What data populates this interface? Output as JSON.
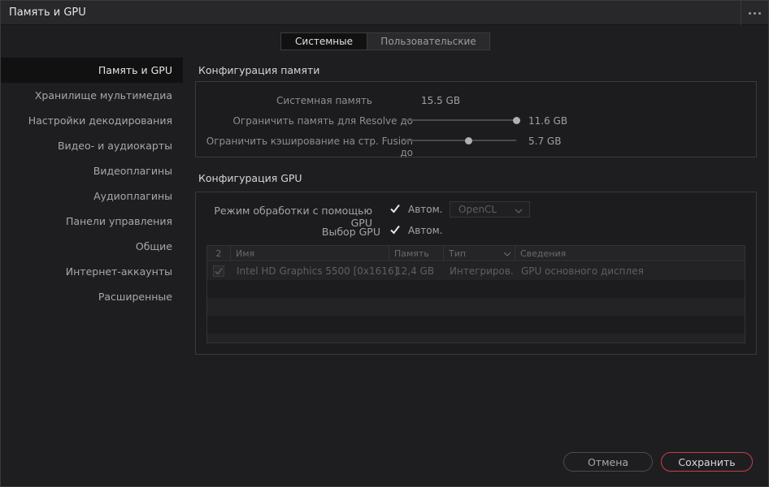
{
  "window": {
    "title": "Память и GPU"
  },
  "tabs": [
    {
      "label": "Системные",
      "active": true
    },
    {
      "label": "Пользовательские",
      "active": false
    }
  ],
  "sidebar": {
    "items": [
      {
        "label": "Память и GPU",
        "active": true
      },
      {
        "label": "Хранилище мультимедиа"
      },
      {
        "label": "Настройки декодирования"
      },
      {
        "label": "Видео- и аудиокарты"
      },
      {
        "label": "Видеоплагины"
      },
      {
        "label": "Аудиоплагины"
      },
      {
        "label": "Панели управления"
      },
      {
        "label": "Общие"
      },
      {
        "label": "Интернет-аккаунты"
      },
      {
        "label": "Расширенные"
      }
    ]
  },
  "memory": {
    "title": "Конфигурация памяти",
    "system_memory_label": "Системная память",
    "system_memory_value": "15.5 GB",
    "resolve_limit_label": "Ограничить память для Resolve до",
    "resolve_limit_value": "11.6 GB",
    "resolve_limit_fraction": 1.0,
    "fusion_limit_label": "Ограничить кэширование на стр. Fusion до",
    "fusion_limit_value": "5.7 GB",
    "fusion_limit_fraction": 0.58
  },
  "gpu": {
    "title": "Конфигурация GPU",
    "processing_mode_label": "Режим обработки с помощью GPU",
    "processing_auto_label": "Автом.",
    "processing_auto_checked": true,
    "processing_api": "OpenCL",
    "gpu_select_label": "Выбор GPU",
    "gpu_select_auto_label": "Автом.",
    "gpu_select_auto_checked": true,
    "table": {
      "columns": [
        "2",
        "Имя",
        "Память",
        "Тип",
        "Сведения"
      ],
      "rows": [
        {
          "checked": true,
          "name": "Intel HD Graphics 5500 [0x1616]",
          "memory": "12,4 GB",
          "type": "Интегриров.",
          "details": "GPU основного дисплея"
        }
      ]
    }
  },
  "footer": {
    "cancel_label": "Отмена",
    "save_label": "Сохранить"
  },
  "colors": {
    "accent": "#c4404a",
    "background": "#1e1e20",
    "selected": "#111112"
  }
}
